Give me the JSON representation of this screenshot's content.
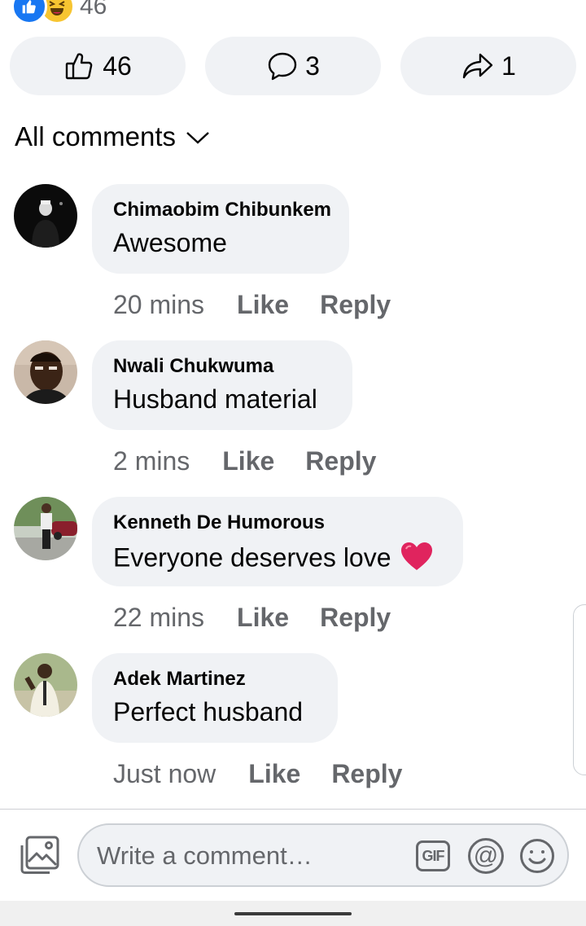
{
  "reactions": {
    "count": "46",
    "types": [
      "like-icon",
      "haha-icon"
    ]
  },
  "actions": {
    "like_count": "46",
    "comment_count": "3",
    "share_count": "1"
  },
  "filter": {
    "label": "All comments"
  },
  "comments": [
    {
      "name": "Chimaobim Chibunkem",
      "text": "Awesome",
      "time": "20 mins",
      "like": "Like",
      "reply": "Reply"
    },
    {
      "name": "Nwali Chukwuma",
      "text": "Husband material",
      "time": "2 mins",
      "like": "Like",
      "reply": "Reply"
    },
    {
      "name": "Kenneth De Humorous",
      "text": "Everyone deserves love",
      "emoji": "red-heart-icon",
      "time": "22 mins",
      "like": "Like",
      "reply": "Reply"
    },
    {
      "name": "Adek Martinez",
      "text": "Perfect husband",
      "time": "Just now",
      "like": "Like",
      "reply": "Reply"
    }
  ],
  "composer": {
    "placeholder": "Write a comment…",
    "gif_label": "GIF",
    "mention_label": "@"
  },
  "colors": {
    "bubble": "#f0f2f5",
    "secondary_text": "#65676b",
    "primary_text": "#050505",
    "like_blue": "#1877f2",
    "heart_red": "#e0245e"
  }
}
